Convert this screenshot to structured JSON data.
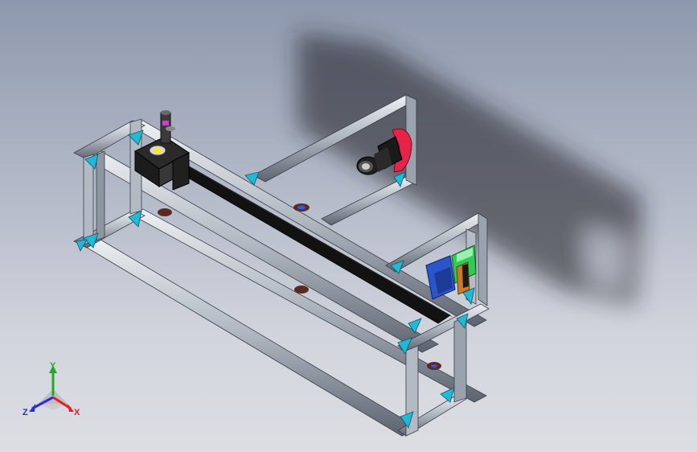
{
  "viewport": {
    "background_top": "#8e98ad",
    "background_bottom": "#dcdee3"
  },
  "model": {
    "frame_color": "#c7cdd6",
    "bracket_color": "#23b8d6",
    "belt_color": "#111111",
    "camera_mount_color": "#e8234a",
    "motor_mount_color": "#2b55c8",
    "driver_color": "#2ecc55"
  },
  "triad": {
    "x_label": "X",
    "y_label": "Y",
    "z_label": "Z",
    "x_color": "#e02020",
    "y_color": "#22aa22",
    "z_color": "#2a2ae0"
  }
}
